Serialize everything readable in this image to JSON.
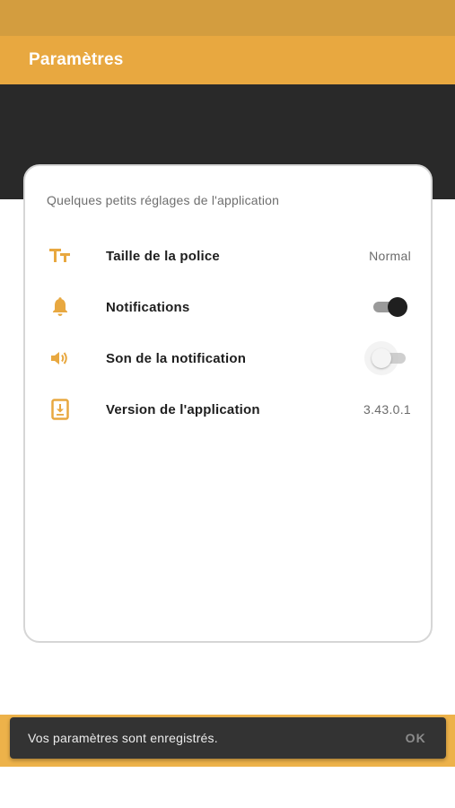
{
  "app_bar": {
    "title": "Paramètres"
  },
  "card": {
    "intro": "Quelques petits réglages de l'application",
    "rows": [
      {
        "icon": "text-size-icon",
        "label": "Taille de la police",
        "value": "Normal"
      },
      {
        "icon": "bell-icon",
        "label": "Notifications",
        "switch_on": true
      },
      {
        "icon": "speaker-icon",
        "label": "Son de la notification",
        "switch_on": false
      },
      {
        "icon": "app-download-icon",
        "label": "Version de l'application",
        "value": "3.43.0.1"
      }
    ]
  },
  "snackbar": {
    "message": "Vos paramètres sont enregistrés.",
    "action": "OK"
  },
  "colors": {
    "accent": "#e8a840",
    "status_bar": "#d39d3f",
    "dark_band": "#292929",
    "snackbar_bg": "#333333"
  }
}
